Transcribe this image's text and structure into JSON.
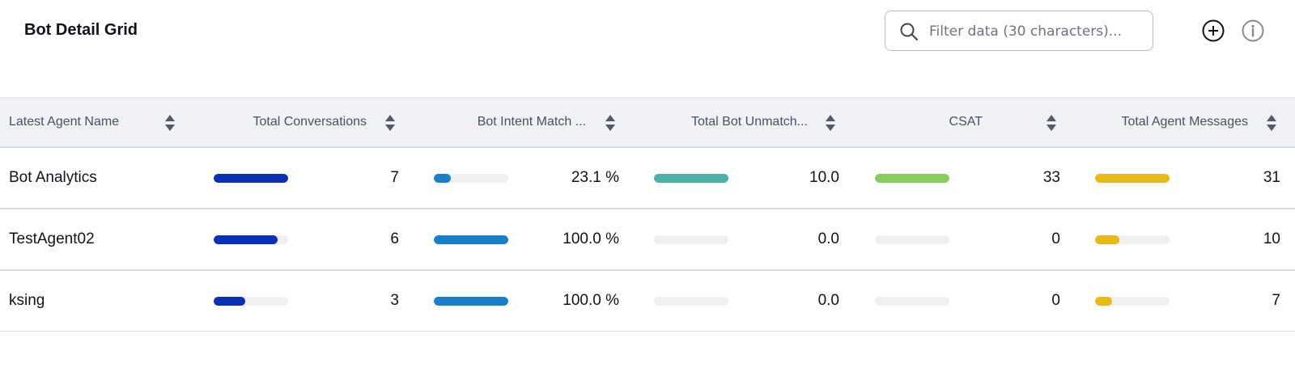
{
  "header": {
    "title": "Bot Detail Grid",
    "search_placeholder": "Filter data (30 characters)..."
  },
  "columns": [
    "Latest Agent Name",
    "Total Conversations",
    "Bot Intent Match ...",
    "Total Bot Unmatch...",
    "CSAT",
    "Total Agent Messages"
  ],
  "bar_colors": {
    "conversations": "#0a31b5",
    "intent_match": "#1a7fc9",
    "unmatched": "#4db0a6",
    "csat": "#86cd5b",
    "agent_messages": "#e8bb12",
    "track": "#efeff0"
  },
  "rows": [
    {
      "agent": "Bot Analytics",
      "conversations": "7",
      "conversations_level": 1.0,
      "intent_match": "23.1 %",
      "intent_match_level": 0.231,
      "unmatched": "10.0",
      "unmatched_level": 1.0,
      "csat": "33",
      "csat_level": 1.0,
      "agent_messages": "31",
      "agent_messages_level": 1.0
    },
    {
      "agent": "TestAgent02",
      "conversations": "6",
      "conversations_level": 0.857,
      "intent_match": "100.0 %",
      "intent_match_level": 1.0,
      "unmatched": "0.0",
      "unmatched_level": 0.0,
      "csat": "0",
      "csat_level": 0.0,
      "agent_messages": "10",
      "agent_messages_level": 0.323
    },
    {
      "agent": "ksing",
      "conversations": "3",
      "conversations_level": 0.429,
      "intent_match": "100.0 %",
      "intent_match_level": 1.0,
      "unmatched": "0.0",
      "unmatched_level": 0.0,
      "csat": "0",
      "csat_level": 0.0,
      "agent_messages": "7",
      "agent_messages_level": 0.226
    }
  ]
}
